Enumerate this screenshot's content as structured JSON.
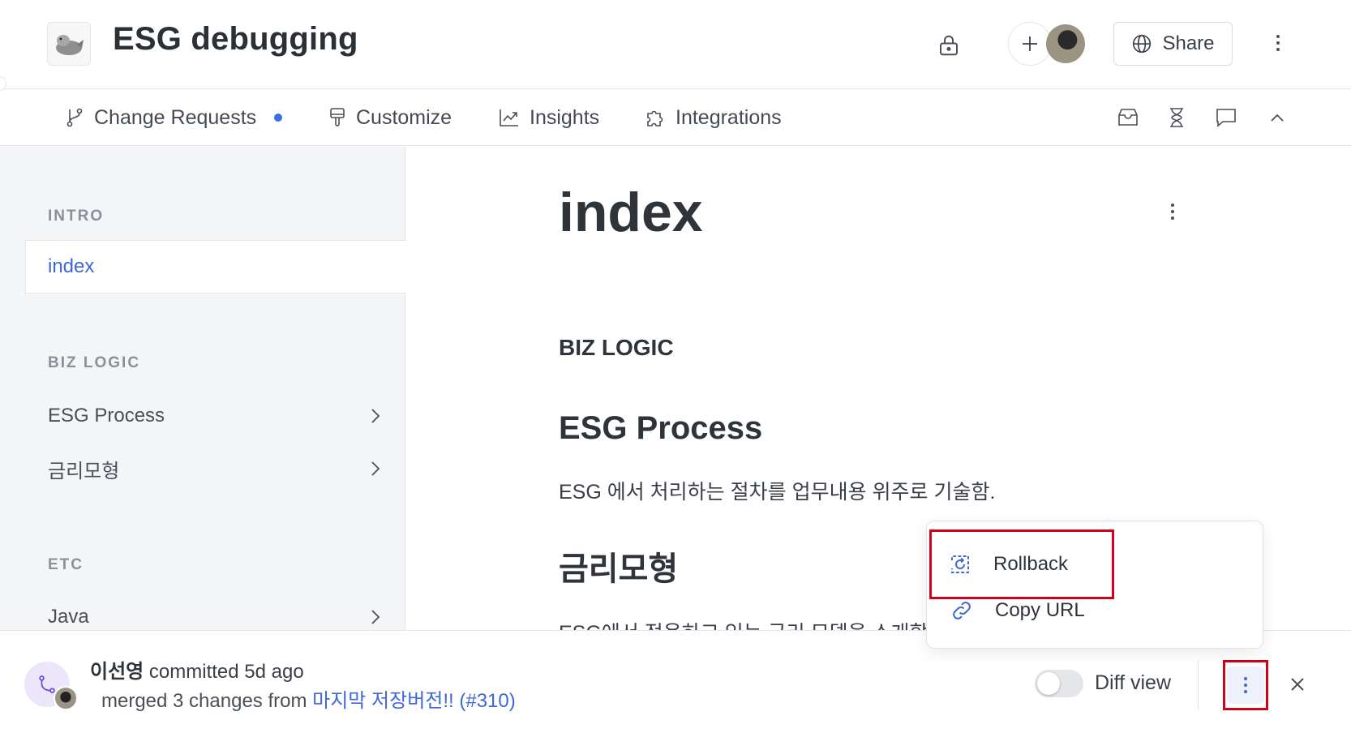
{
  "header": {
    "space_title": "ESG debugging",
    "share_label": "Share"
  },
  "tabs": {
    "change_requests": "Change Requests",
    "customize": "Customize",
    "insights": "Insights",
    "integrations": "Integrations"
  },
  "sidebar": {
    "sections": [
      {
        "label": "INTRO",
        "items": [
          {
            "label": "index",
            "active": true
          }
        ]
      },
      {
        "label": "BIZ LOGIC",
        "items": [
          {
            "label": "ESG Process"
          },
          {
            "label": "금리모형"
          }
        ]
      },
      {
        "label": "ETC",
        "items": [
          {
            "label": "Java"
          }
        ]
      }
    ]
  },
  "content": {
    "title": "index",
    "biz_heading": "BIZ LOGIC",
    "esg_heading": "ESG Process",
    "esg_text": "ESG 에서 처리하는 절차를 업무내용 위주로 기술함.",
    "rate_heading": "금리모형",
    "rate_text": "ESG에서 적용하고 있는 금리 모델을 소개합니다."
  },
  "menu": {
    "rollback": "Rollback",
    "copy_url": "Copy URL"
  },
  "commit": {
    "author": "이선영",
    "action": " committed 5d ago",
    "merged_prefix": "merged 3 changes from ",
    "link": "마지막 저장버전!! (#310)",
    "diff_view": "Diff view"
  },
  "colors": {
    "accent": "#3f67d6",
    "highlight_border": "#d0021b",
    "sidebar_bg": "#f4f5f7"
  }
}
